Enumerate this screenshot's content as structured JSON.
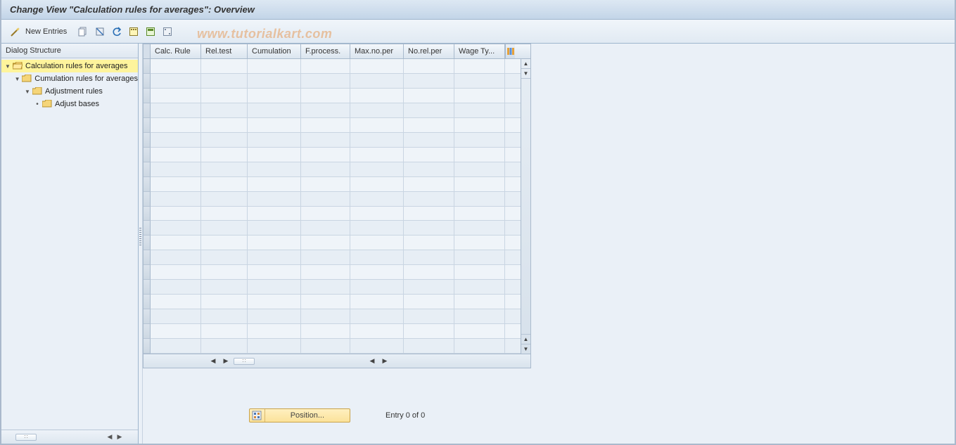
{
  "title": "Change View \"Calculation rules for averages\": Overview",
  "toolbar": {
    "new_entries_label": "New Entries"
  },
  "watermark": "www.tutorialkart.com",
  "sidebar": {
    "header": "Dialog Structure",
    "nodes": [
      {
        "label": "Calculation rules for averages",
        "selected": true
      },
      {
        "label": "Cumulation rules for averages"
      },
      {
        "label": "Adjustment rules"
      },
      {
        "label": "Adjust bases"
      }
    ]
  },
  "grid": {
    "columns": [
      "Calc. Rule",
      "Rel.test",
      "Cumulation",
      "F.process.",
      "Max.no.per",
      "No.rel.per",
      "Wage Ty..."
    ]
  },
  "footer": {
    "position_label": "Position...",
    "entry_text": "Entry 0 of 0"
  }
}
